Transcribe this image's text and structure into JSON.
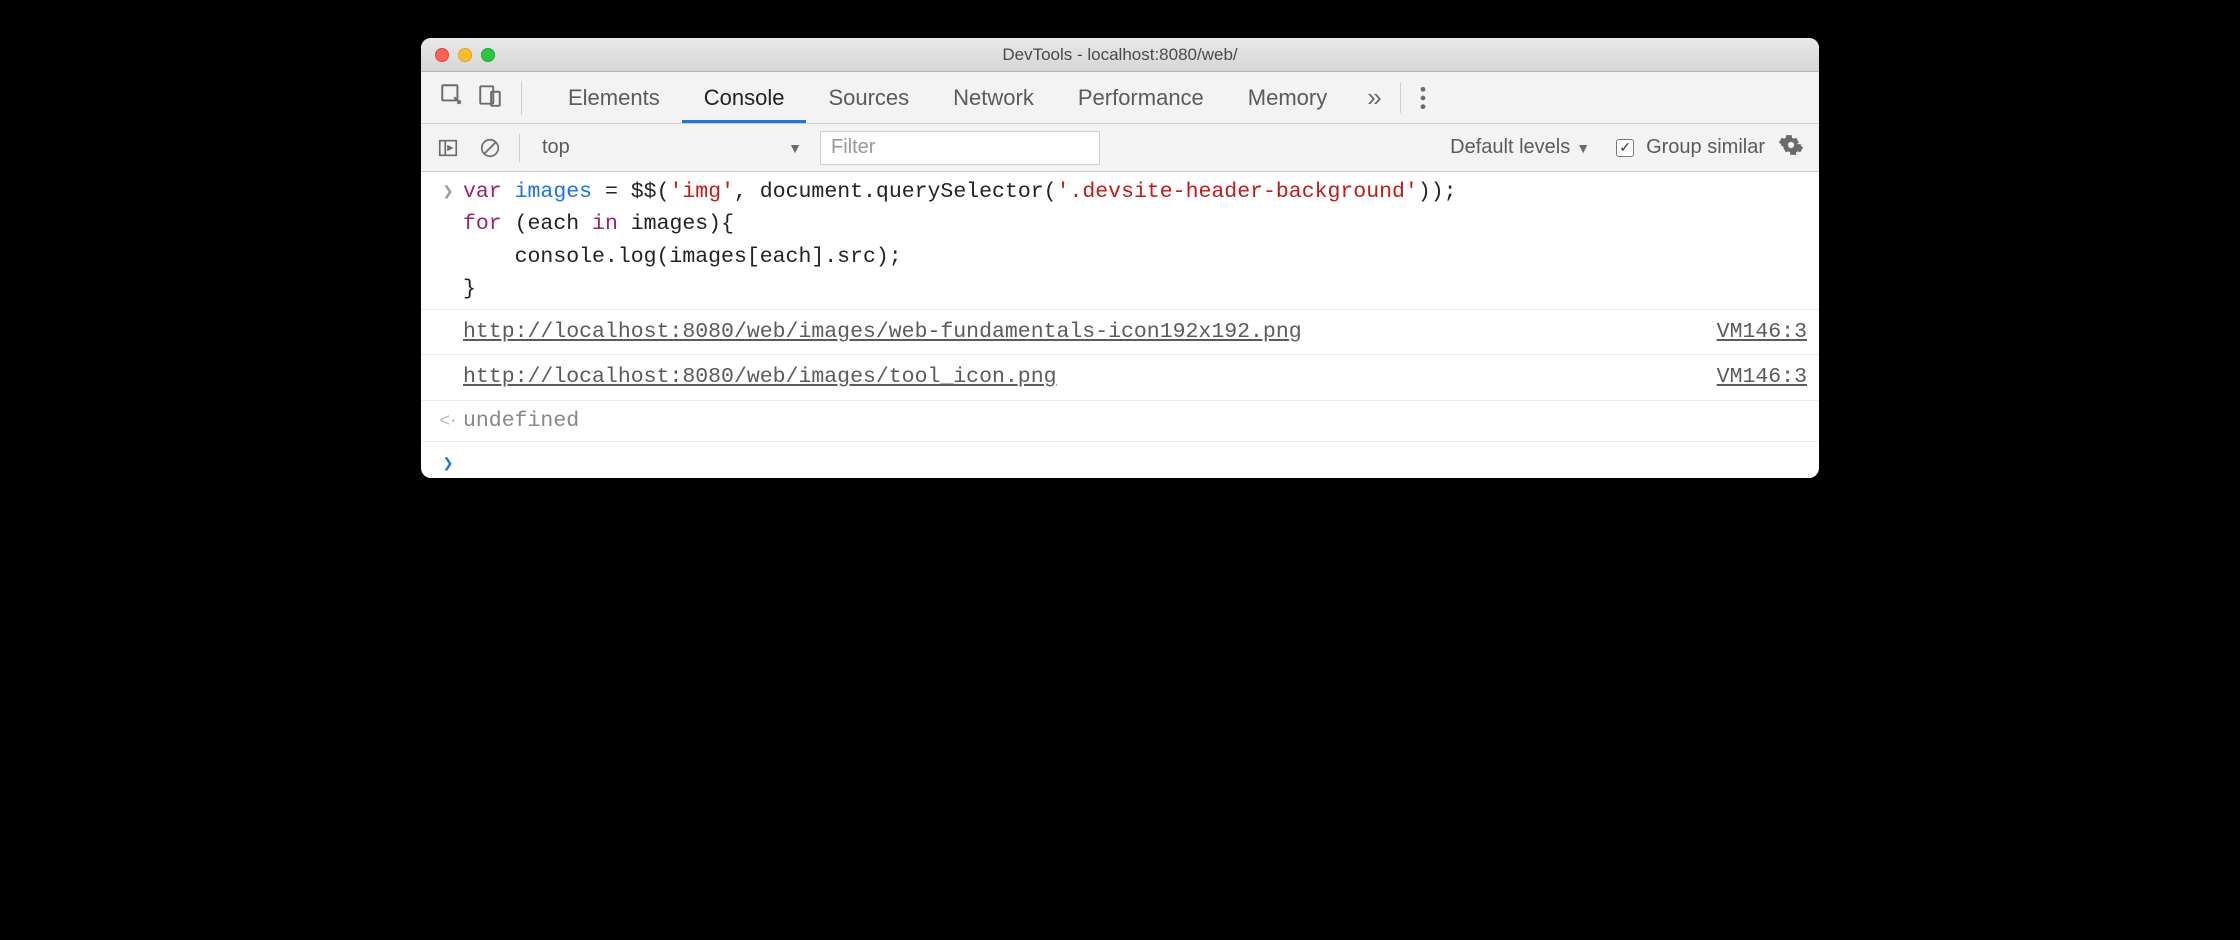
{
  "window": {
    "title": "DevTools - localhost:8080/web/"
  },
  "tabs": {
    "items": [
      "Elements",
      "Console",
      "Sources",
      "Network",
      "Performance",
      "Memory"
    ],
    "active_index": 1,
    "overflow_glyph": "»"
  },
  "subtoolbar": {
    "context": "top",
    "filter_placeholder": "Filter",
    "levels_label": "Default levels",
    "group_similar_label": "Group similar",
    "group_similar_checked": true
  },
  "console": {
    "input_code": {
      "line1_kw1": "var",
      "line1_var1": "images",
      "line1_eq": " = ",
      "line1_fn": "$$(",
      "line1_str1": "'img'",
      "line1_mid": ", document.querySelector(",
      "line1_str2": "'.devsite-header-background'",
      "line1_end": "));",
      "line2_pre": "for",
      "line2_mid1": " (each ",
      "line2_in": "in",
      "line2_mid2": " images){",
      "line3": "    console.log(images[each].src);",
      "line4": "}"
    },
    "logs": [
      {
        "text": "http://localhost:8080/web/images/web-fundamentals-icon192x192.png",
        "source": "VM146:3"
      },
      {
        "text": "http://localhost:8080/web/images/tool_icon.png",
        "source": "VM146:3"
      }
    ],
    "return_value": "undefined"
  }
}
